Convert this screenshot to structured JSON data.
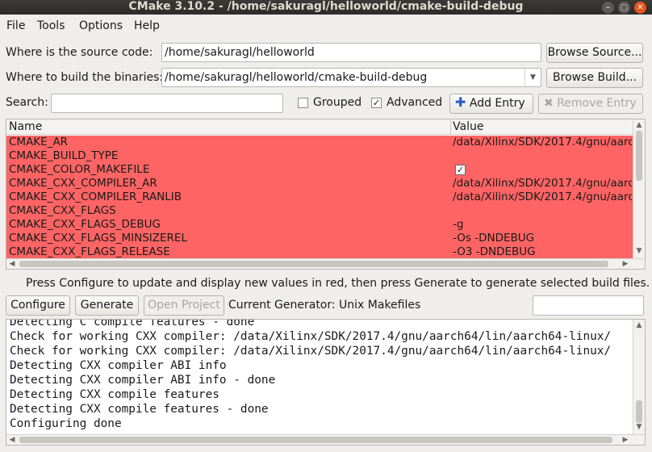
{
  "window": {
    "title": "CMake 3.10.2 - /home/sakuragl/helloworld/cmake-build-debug"
  },
  "menu": [
    {
      "label": "File"
    },
    {
      "label": "Tools"
    },
    {
      "label": "Options"
    },
    {
      "label": "Help"
    }
  ],
  "source": {
    "label": "Where is the source code:",
    "value": "/home/sakuragl/helloworld",
    "browse": "Browse Source..."
  },
  "build": {
    "label": "Where to build the binaries:",
    "value": "/home/sakuragl/helloworld/cmake-build-debug",
    "browse": "Browse Build..."
  },
  "search": {
    "label": "Search:",
    "value": ""
  },
  "options": {
    "grouped": {
      "label": "Grouped",
      "checked": false
    },
    "advanced": {
      "label": "Advanced",
      "checked": true
    }
  },
  "entry_buttons": {
    "add": "Add Entry",
    "remove": "Remove Entry"
  },
  "table": {
    "headers": {
      "name": "Name",
      "value": "Value"
    },
    "row_color": "#ff6464",
    "rows": [
      {
        "name": "CMAKE_AR",
        "value": "/data/Xilinx/SDK/2017.4/gnu/aarc"
      },
      {
        "name": "CMAKE_BUILD_TYPE",
        "value": ""
      },
      {
        "name": "CMAKE_COLOR_MAKEFILE",
        "value": "",
        "checkbox": true
      },
      {
        "name": "CMAKE_CXX_COMPILER_AR",
        "value": "/data/Xilinx/SDK/2017.4/gnu/aarc"
      },
      {
        "name": "CMAKE_CXX_COMPILER_RANLIB",
        "value": "/data/Xilinx/SDK/2017.4/gnu/aarc"
      },
      {
        "name": "CMAKE_CXX_FLAGS",
        "value": ""
      },
      {
        "name": "CMAKE_CXX_FLAGS_DEBUG",
        "value": "-g"
      },
      {
        "name": "CMAKE_CXX_FLAGS_MINSIZEREL",
        "value": "-Os -DNDEBUG"
      },
      {
        "name": "CMAKE_CXX_FLAGS_RELEASE",
        "value": "-O3 -DNDEBUG"
      }
    ]
  },
  "hint": "Press Configure to update and display new values in red, then press Generate to generate selected build files.",
  "actions": {
    "configure": "Configure",
    "generate": "Generate",
    "open_project": "Open Project",
    "generator": "Current Generator: Unix Makefiles"
  },
  "log": [
    "Detecting C compile features - done",
    "Check for working CXX compiler: /data/Xilinx/SDK/2017.4/gnu/aarch64/lin/aarch64-linux/",
    "Check for working CXX compiler: /data/Xilinx/SDK/2017.4/gnu/aarch64/lin/aarch64-linux/",
    "Detecting CXX compiler ABI info",
    "Detecting CXX compiler ABI info - done",
    "Detecting CXX compile features",
    "Detecting CXX compile features - done",
    "Configuring done"
  ]
}
